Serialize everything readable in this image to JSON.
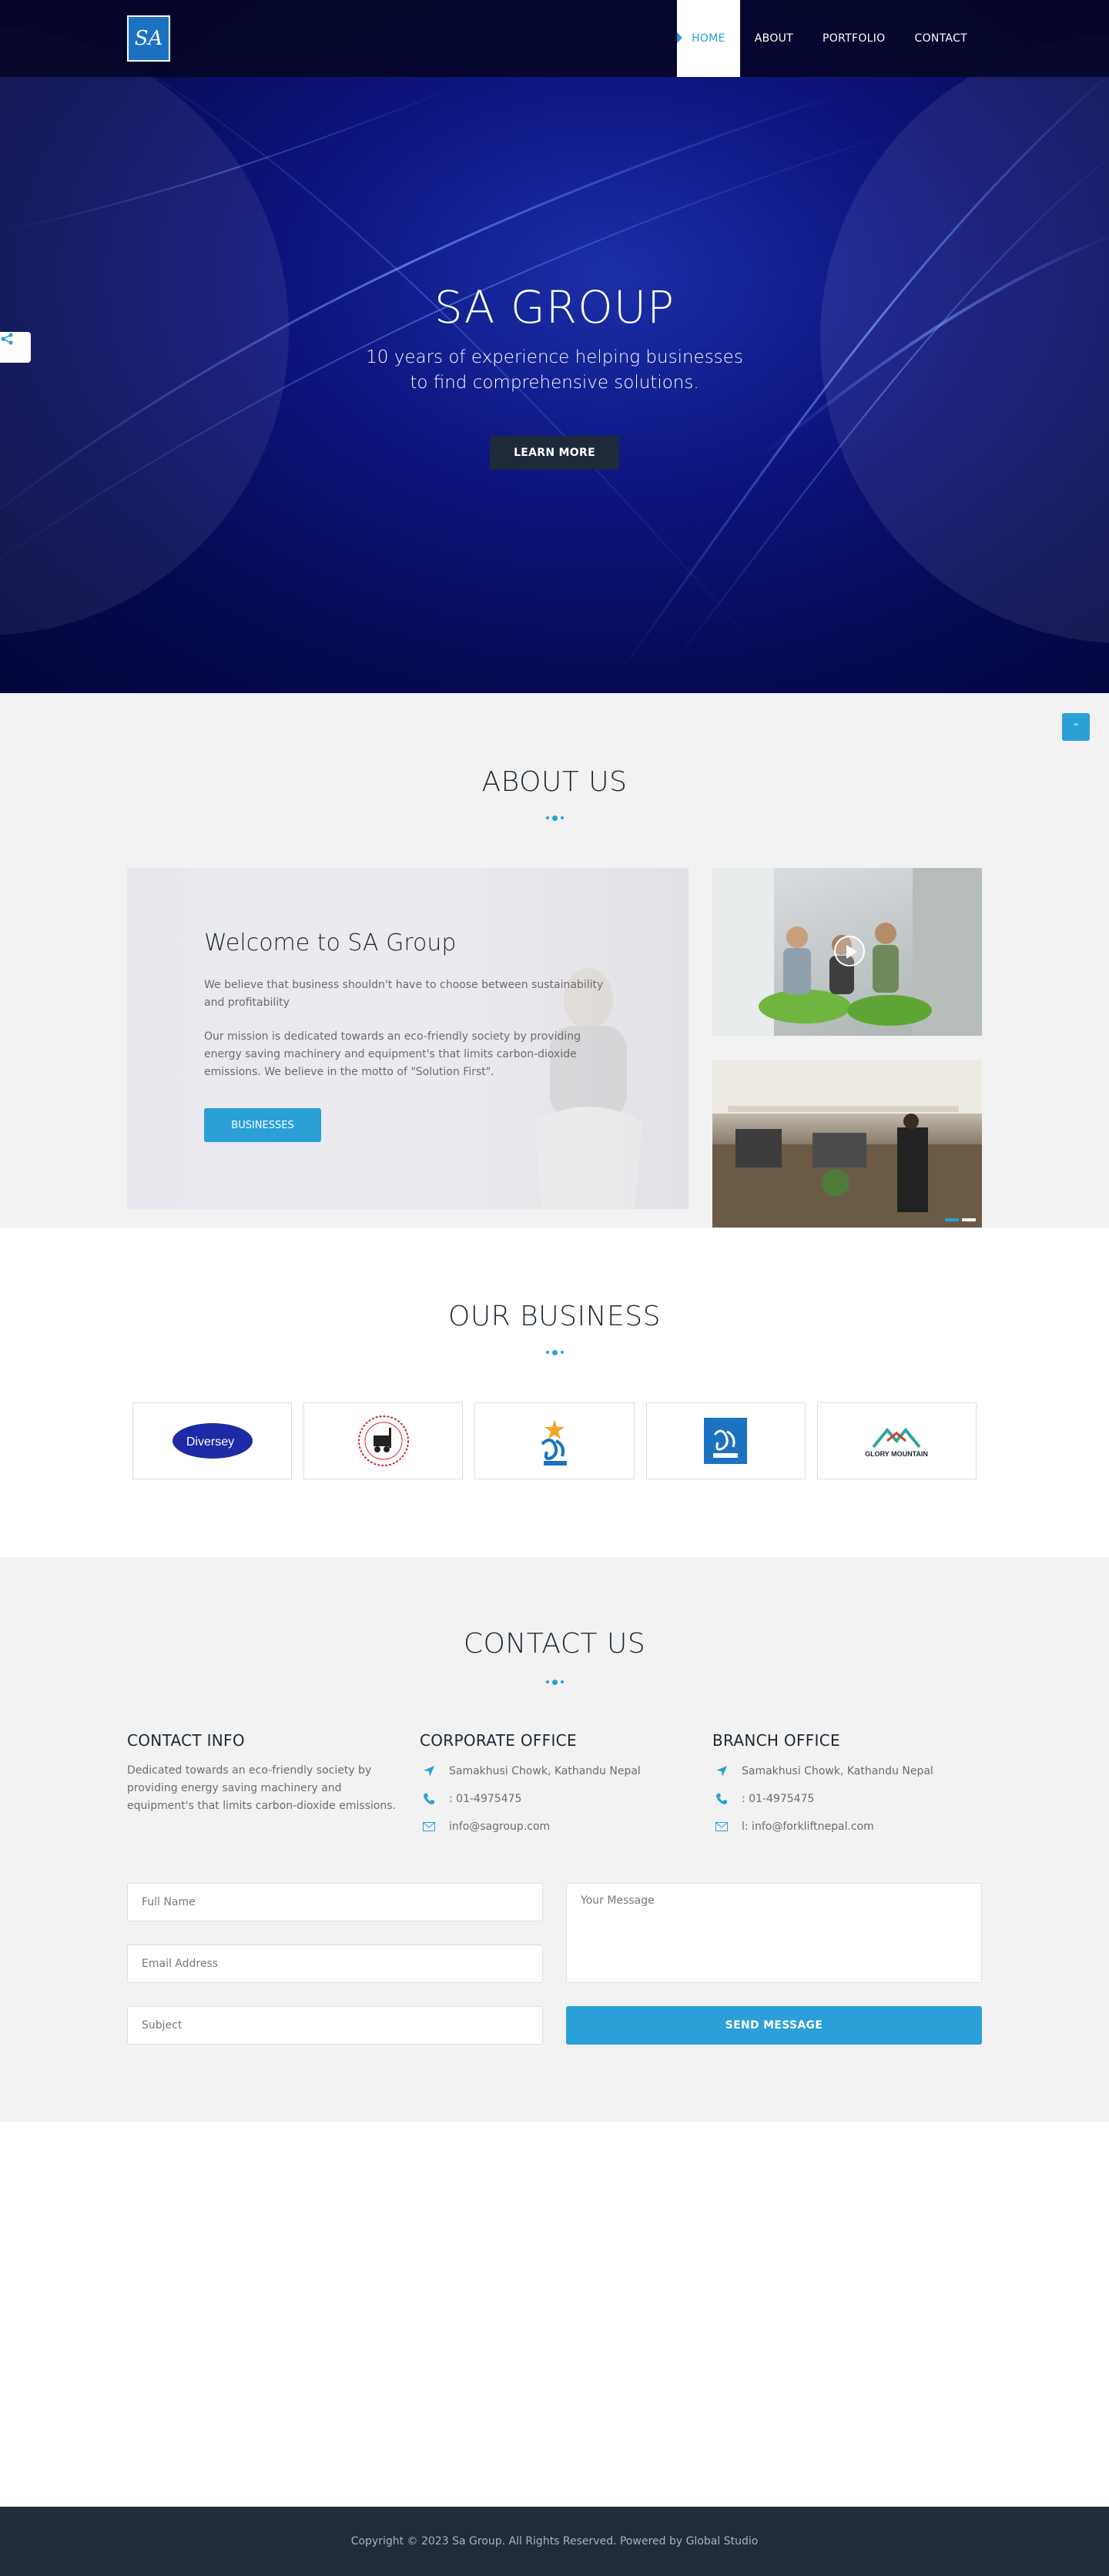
{
  "colors": {
    "accent": "#2a9fd8",
    "dark": "#1c2833",
    "footer": "#212b3a"
  },
  "nav": {
    "logo_text": "SA",
    "items": [
      {
        "label": "HOME",
        "active": true
      },
      {
        "label": "ABOUT",
        "active": false
      },
      {
        "label": "PORTFOLIO",
        "active": false
      },
      {
        "label": "CONTACT",
        "active": false
      }
    ]
  },
  "hero": {
    "title": "SA GROUP",
    "subtitle": "10 years of experience helping businesses to find comprehensive solutions.",
    "button": "LEARN MORE"
  },
  "about": {
    "section_title": "ABOUT US",
    "heading": "Welcome to SA Group",
    "paragraph1": "We believe that business shouldn't have to choose between sustainability and profitability",
    "paragraph2": "Our mission is dedicated towards an eco-friendly society by providing energy saving machinery and equipment's that limits carbon-dioxide emissions. We believe in the motto of \"Solution First\".",
    "button": "BUSINESSES"
  },
  "business": {
    "section_title": "OUR BUSINESS",
    "logos": [
      {
        "name": "Diversey",
        "icon": "diversey-logo"
      },
      {
        "name": "",
        "icon": "forklift-seal-logo"
      },
      {
        "name": "",
        "icon": "sa-figure-logo"
      },
      {
        "name": "",
        "icon": "sa-group-logo"
      },
      {
        "name": "GLORY MOUNTAIN",
        "icon": "glory-mountain-logo"
      }
    ]
  },
  "contact": {
    "section_title": "CONTACT US",
    "info": {
      "title": "CONTACT INFO",
      "text": "Dedicated towards an eco-friendly society by providing energy saving machinery and equipment's that limits carbon-dioxide emissions."
    },
    "corporate": {
      "title": "CORPORATE OFFICE",
      "address": "Samakhusi Chowk, Kathandu Nepal",
      "phone": ": 01-4975475",
      "email": "info@sagroup.com"
    },
    "branch": {
      "title": "BRANCH OFFICE",
      "address": "Samakhusi Chowk, Kathandu Nepal",
      "phone": ": 01-4975475",
      "email": "l: info@forkliftnepal.com"
    },
    "form": {
      "name_placeholder": "Full Name",
      "email_placeholder": "Email Address",
      "subject_placeholder": "Subject",
      "message_placeholder": "Your Message",
      "send": "SEND MESSAGE"
    }
  },
  "footer": {
    "copyright": "Copyright © 2023 Sa Group. All Rights Reserved. Powered by Global Studio"
  }
}
